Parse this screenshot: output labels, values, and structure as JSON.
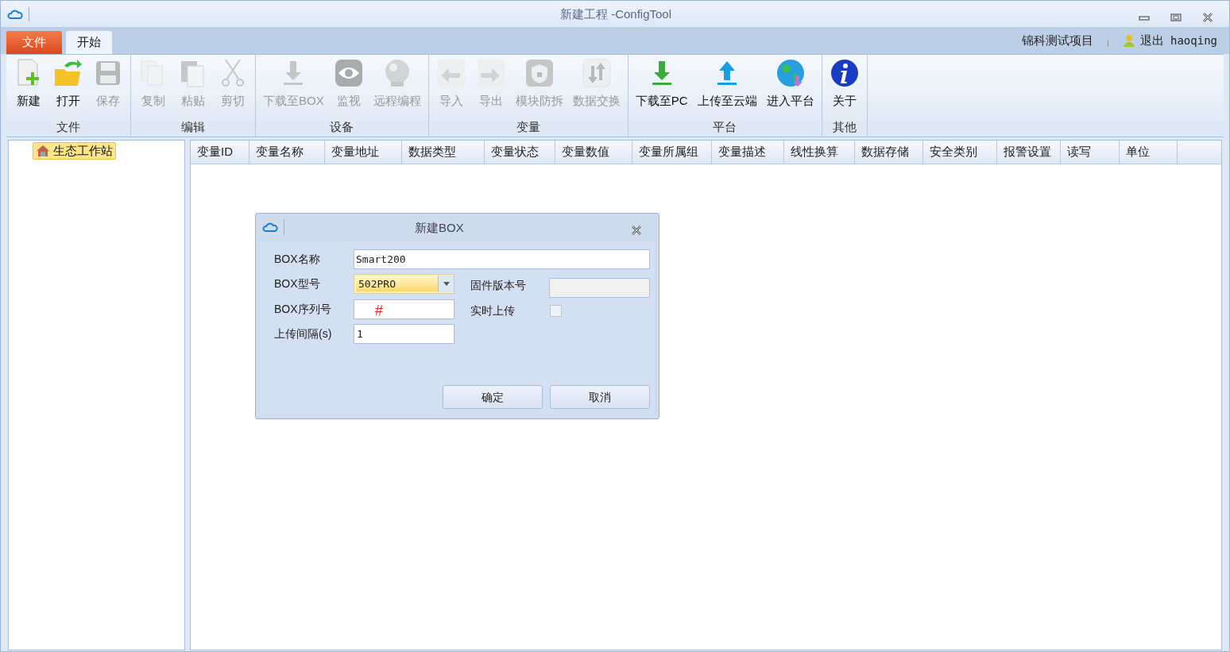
{
  "window": {
    "title": "新建工程 -ConfigTool"
  },
  "menu_tabs": [
    {
      "label": "文件",
      "kind": "app"
    },
    {
      "label": "开始",
      "kind": "tab",
      "selected": true
    }
  ],
  "account": {
    "project": "锦科测试项目",
    "logout": "退出",
    "user": "haoqing"
  },
  "ribbon_groups": [
    {
      "label": "文件",
      "buttons": [
        {
          "label": "新建",
          "disabled": false
        },
        {
          "label": "打开",
          "disabled": false
        },
        {
          "label": "保存",
          "disabled": true
        }
      ]
    },
    {
      "label": "编辑",
      "buttons": [
        {
          "label": "复制",
          "disabled": true
        },
        {
          "label": "粘贴",
          "disabled": true
        },
        {
          "label": "剪切",
          "disabled": true
        }
      ]
    },
    {
      "label": "设备",
      "buttons": [
        {
          "label": "下载至BOX",
          "disabled": true
        },
        {
          "label": "监视",
          "disabled": true
        },
        {
          "label": "远程编程",
          "disabled": true
        }
      ]
    },
    {
      "label": "变量",
      "buttons": [
        {
          "label": "导入",
          "disabled": true
        },
        {
          "label": "导出",
          "disabled": true
        },
        {
          "label": "模块防拆",
          "disabled": true
        },
        {
          "label": "数据交换",
          "disabled": true
        }
      ]
    },
    {
      "label": "平台",
      "buttons": [
        {
          "label": "下载至PC",
          "disabled": false
        },
        {
          "label": "上传至云端",
          "disabled": false
        },
        {
          "label": "进入平台",
          "disabled": false
        }
      ]
    },
    {
      "label": "其他",
      "buttons": [
        {
          "label": "关于",
          "disabled": false
        }
      ]
    }
  ],
  "tree": {
    "items": [
      {
        "label": "生态工作站",
        "selected": true
      }
    ]
  },
  "table": {
    "columns": [
      "变量ID",
      "变量名称",
      "变量地址",
      "数据类型",
      "变量状态",
      "变量数值",
      "变量所属组",
      "变量描述",
      "线性换算",
      "数据存储",
      "安全类别",
      "报警设置",
      "读写",
      "单位"
    ]
  },
  "dialog": {
    "title": "新建BOX",
    "name_label": "BOX名称",
    "name_value": "Smart200",
    "model_label": "BOX型号",
    "model_value": "502PRO",
    "firmware_label": "固件版本号",
    "serial_label": "BOX序列号",
    "serial_mark": "#",
    "realtime_label": "实时上传",
    "realtime_checked": false,
    "interval_label": "上传间隔(s)",
    "interval_value": "1",
    "buttons": [
      "确定",
      "取消"
    ]
  }
}
